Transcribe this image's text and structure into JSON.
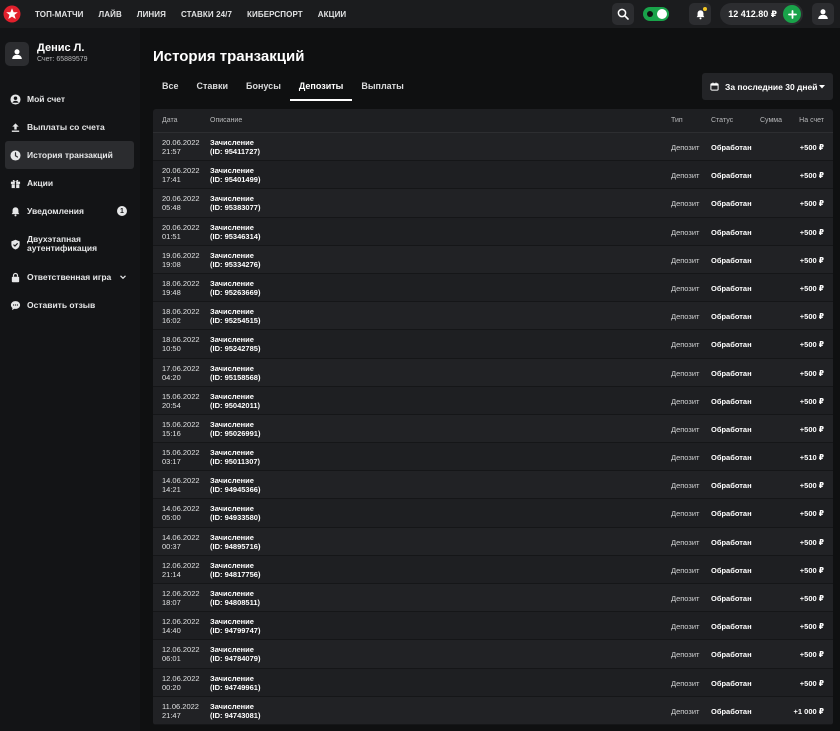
{
  "topbar": {
    "nav": [
      "ТОП-МАТЧИ",
      "ЛАЙВ",
      "ЛИНИЯ",
      "СТАВКИ 24/7",
      "КИБЕРСПОРТ",
      "АКЦИИ"
    ],
    "balance": "12 412.80 ₽"
  },
  "sidebar": {
    "user_name": "Денис Л.",
    "account": "Счет: 65889579",
    "items": [
      {
        "label": "Мой счет",
        "icon": "account-circle-icon"
      },
      {
        "label": "Выплаты со счета",
        "icon": "upload-icon"
      },
      {
        "label": "История транзакций",
        "icon": "history-clock-icon"
      },
      {
        "label": "Акции",
        "icon": "gift-icon"
      },
      {
        "label": "Уведомления",
        "icon": "bell-icon",
        "badge": "1"
      },
      {
        "label": "Двухэтапная аутентификация",
        "icon": "shield-check-icon"
      },
      {
        "label": "Ответственная игра",
        "icon": "lock-icon"
      },
      {
        "label": "Оставить отзыв",
        "icon": "chat-bubble-icon"
      }
    ]
  },
  "main": {
    "title": "История транзакций",
    "tabs": [
      "Все",
      "Ставки",
      "Бонусы",
      "Депозиты",
      "Выплаты"
    ],
    "active_tab": "Депозиты",
    "period": "За последние 30 дней",
    "columns": {
      "date": "Дата",
      "desc": "Описание",
      "type": "Тип",
      "status": "Статус",
      "sum": "Сумма",
      "account": "На счет"
    },
    "rows": [
      {
        "date": "20.06.2022",
        "time": "21:57",
        "desc": "Зачисление",
        "id": "(ID: 95411727)",
        "type": "Депозит",
        "status": "Обработан",
        "amount": "+500 ₽"
      },
      {
        "date": "20.06.2022",
        "time": "17:41",
        "desc": "Зачисление",
        "id": "(ID: 95401499)",
        "type": "Депозит",
        "status": "Обработан",
        "amount": "+500 ₽"
      },
      {
        "date": "20.06.2022",
        "time": "05:48",
        "desc": "Зачисление",
        "id": "(ID: 95383077)",
        "type": "Депозит",
        "status": "Обработан",
        "amount": "+500 ₽"
      },
      {
        "date": "20.06.2022",
        "time": "01:51",
        "desc": "Зачисление",
        "id": "(ID: 95346314)",
        "type": "Депозит",
        "status": "Обработан",
        "amount": "+500 ₽"
      },
      {
        "date": "19.06.2022",
        "time": "19:08",
        "desc": "Зачисление",
        "id": "(ID: 95334276)",
        "type": "Депозит",
        "status": "Обработан",
        "amount": "+500 ₽"
      },
      {
        "date": "18.06.2022",
        "time": "19:48",
        "desc": "Зачисление",
        "id": "(ID: 95263669)",
        "type": "Депозит",
        "status": "Обработан",
        "amount": "+500 ₽"
      },
      {
        "date": "18.06.2022",
        "time": "16:02",
        "desc": "Зачисление",
        "id": "(ID: 95254515)",
        "type": "Депозит",
        "status": "Обработан",
        "amount": "+500 ₽"
      },
      {
        "date": "18.06.2022",
        "time": "10:50",
        "desc": "Зачисление",
        "id": "(ID: 95242785)",
        "type": "Депозит",
        "status": "Обработан",
        "amount": "+500 ₽"
      },
      {
        "date": "17.06.2022",
        "time": "04:20",
        "desc": "Зачисление",
        "id": "(ID: 95158568)",
        "type": "Депозит",
        "status": "Обработан",
        "amount": "+500 ₽"
      },
      {
        "date": "15.06.2022",
        "time": "20:54",
        "desc": "Зачисление",
        "id": "(ID: 95042011)",
        "type": "Депозит",
        "status": "Обработан",
        "amount": "+500 ₽"
      },
      {
        "date": "15.06.2022",
        "time": "15:16",
        "desc": "Зачисление",
        "id": "(ID: 95026991)",
        "type": "Депозит",
        "status": "Обработан",
        "amount": "+500 ₽"
      },
      {
        "date": "15.06.2022",
        "time": "03:17",
        "desc": "Зачисление",
        "id": "(ID: 95011307)",
        "type": "Депозит",
        "status": "Обработан",
        "amount": "+510 ₽"
      },
      {
        "date": "14.06.2022",
        "time": "14:21",
        "desc": "Зачисление",
        "id": "(ID: 94945366)",
        "type": "Депозит",
        "status": "Обработан",
        "amount": "+500 ₽"
      },
      {
        "date": "14.06.2022",
        "time": "05:00",
        "desc": "Зачисление",
        "id": "(ID: 94933580)",
        "type": "Депозит",
        "status": "Обработан",
        "amount": "+500 ₽"
      },
      {
        "date": "14.06.2022",
        "time": "00:37",
        "desc": "Зачисление",
        "id": "(ID: 94895716)",
        "type": "Депозит",
        "status": "Обработан",
        "amount": "+500 ₽"
      },
      {
        "date": "12.06.2022",
        "time": "21:14",
        "desc": "Зачисление",
        "id": "(ID: 94817756)",
        "type": "Депозит",
        "status": "Обработан",
        "amount": "+500 ₽"
      },
      {
        "date": "12.06.2022",
        "time": "18:07",
        "desc": "Зачисление",
        "id": "(ID: 94808511)",
        "type": "Депозит",
        "status": "Обработан",
        "amount": "+500 ₽"
      },
      {
        "date": "12.06.2022",
        "time": "14:40",
        "desc": "Зачисление",
        "id": "(ID: 94799747)",
        "type": "Депозит",
        "status": "Обработан",
        "amount": "+500 ₽"
      },
      {
        "date": "12.06.2022",
        "time": "06:01",
        "desc": "Зачисление",
        "id": "(ID: 94784079)",
        "type": "Депозит",
        "status": "Обработан",
        "amount": "+500 ₽"
      },
      {
        "date": "12.06.2022",
        "time": "00:20",
        "desc": "Зачисление",
        "id": "(ID: 94749961)",
        "type": "Депозит",
        "status": "Обработан",
        "amount": "+500 ₽"
      },
      {
        "date": "11.06.2022",
        "time": "21:47",
        "desc": "Зачисление",
        "id": "(ID: 94743081)",
        "type": "Депозит",
        "status": "Обработан",
        "amount": "+1 000 ₽"
      }
    ]
  }
}
